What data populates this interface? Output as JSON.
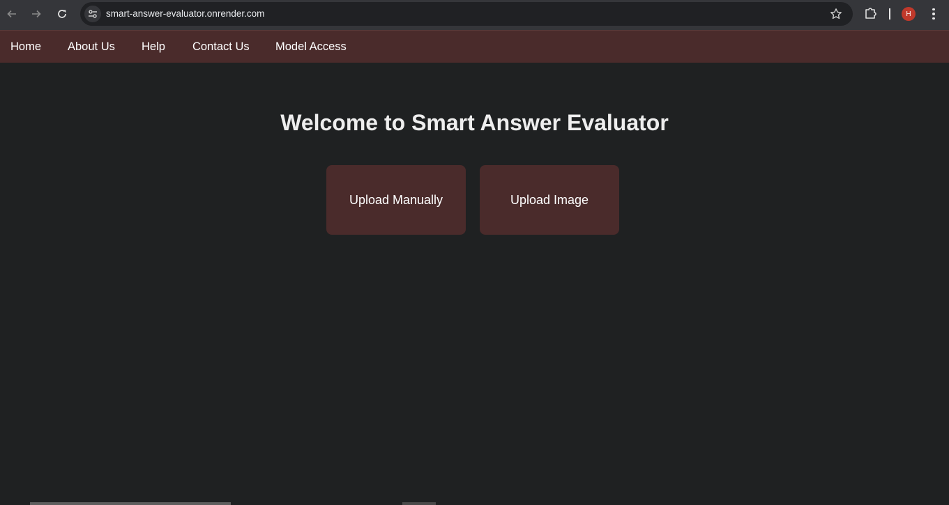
{
  "browser": {
    "url": "smart-answer-evaluator.onrender.com",
    "profile_initial": "H",
    "back_icon": "arrow-left-icon",
    "forward_icon": "arrow-right-icon",
    "reload_icon": "reload-icon",
    "site_info_icon": "tune-icon",
    "bookmark_icon": "star-icon",
    "extensions_icon": "puzzle-icon",
    "menu_icon": "kebab-menu-icon"
  },
  "nav": {
    "items": [
      {
        "label": "Home"
      },
      {
        "label": "About Us"
      },
      {
        "label": "Help"
      },
      {
        "label": "Contact Us"
      },
      {
        "label": "Model Access"
      }
    ]
  },
  "main": {
    "title": "Welcome to Smart Answer Evaluator",
    "actions": [
      {
        "label": "Upload Manually"
      },
      {
        "label": "Upload Image"
      }
    ]
  },
  "colors": {
    "page_bg": "#1f2122",
    "nav_bg": "#4a2b2b",
    "card_bg": "#4a2b2b",
    "title_text": "#eeeeee",
    "avatar_bg": "#c0392b"
  }
}
